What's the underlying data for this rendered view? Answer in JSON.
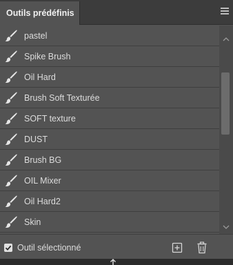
{
  "panel": {
    "tab_title": "Outils prédéfinis",
    "menu_icon": "hamburger-menu-icon"
  },
  "presets": [
    {
      "label": "pastel",
      "icon": "brush-icon"
    },
    {
      "label": "Spike Brush",
      "icon": "brush-icon"
    },
    {
      "label": "Oil Hard",
      "icon": "brush-icon"
    },
    {
      "label": "Brush Soft Texturée",
      "icon": "brush-icon"
    },
    {
      "label": "SOFT texture",
      "icon": "brush-icon"
    },
    {
      "label": "DUST",
      "icon": "brush-icon"
    },
    {
      "label": "Brush BG",
      "icon": "brush-icon"
    },
    {
      "label": "OIL Mixer",
      "icon": "brush-icon"
    },
    {
      "label": "Oil Hard2",
      "icon": "brush-icon"
    },
    {
      "label": "Skin",
      "icon": "brush-icon"
    }
  ],
  "footer": {
    "current_tool_only_label": "Outil sélectionné",
    "current_tool_only_checked": true,
    "new_preset_icon": "new-preset-icon",
    "delete_icon": "trash-icon"
  },
  "scroll": {
    "position_fraction": 0.24
  },
  "colors": {
    "panel_bg": "#535353",
    "tabbar_bg": "#3c3c3c",
    "text": "#dcdcdc",
    "icon": "#e6e6e6"
  }
}
